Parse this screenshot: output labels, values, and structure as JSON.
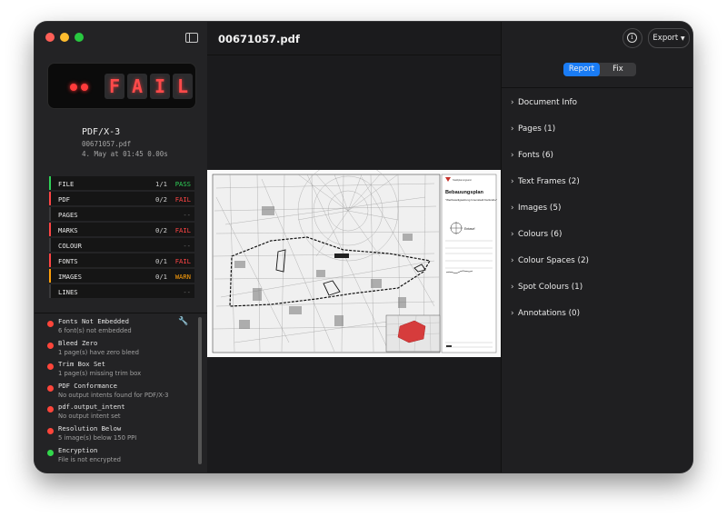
{
  "window": {
    "title": "00671057.pdf"
  },
  "summary": {
    "result_text": [
      "F",
      "A",
      "I",
      "L"
    ],
    "standard": "PDF/X-3",
    "filename": "00671057.pdf",
    "timestamp": "4. May at 01:45  0.00s"
  },
  "checks": [
    {
      "label": "FILE",
      "count": "1/1",
      "status": "PASS",
      "color": "#2fd158"
    },
    {
      "label": "PDF",
      "count": "0/2",
      "status": "FAIL",
      "color": "#ff4545"
    },
    {
      "label": "PAGES",
      "count": "",
      "status": "--",
      "color": "#3a3a3c"
    },
    {
      "label": "MARKS",
      "count": "0/2",
      "status": "FAIL",
      "color": "#ff4545"
    },
    {
      "label": "COLOUR",
      "count": "",
      "status": "--",
      "color": "#3a3a3c"
    },
    {
      "label": "FONTS",
      "count": "0/1",
      "status": "FAIL",
      "color": "#ff4545"
    },
    {
      "label": "IMAGES",
      "count": "0/1",
      "status": "WARN",
      "color": "#ff9f0a"
    },
    {
      "label": "LINES",
      "count": "",
      "status": "--",
      "color": "#3a3a3c"
    }
  ],
  "issues": [
    {
      "title": "Fonts Not Embedded",
      "subtitle": "6 font(s) not embedded",
      "color": "#ff453a"
    },
    {
      "title": "Bleed Zero",
      "subtitle": "1 page(s) have zero bleed",
      "color": "#ff453a"
    },
    {
      "title": "Trim Box Set",
      "subtitle": "1 page(s) missing trim box",
      "color": "#ff453a"
    },
    {
      "title": "PDF Conformance",
      "subtitle": "No output intents found for PDF/X-3",
      "color": "#ff453a"
    },
    {
      "title": "pdf.output_intent",
      "subtitle": "No output intent set",
      "color": "#ff453a"
    },
    {
      "title": "Resolution Below",
      "subtitle": "5 image(s) below 150 PPI",
      "color": "#ff453a"
    },
    {
      "title": "Encryption",
      "subtitle": "File is not encrypted",
      "color": "#32d74b"
    }
  ],
  "document": {
    "plan_title": "Bebauungsplan",
    "plan_subtitle": "\"Wertbeteiligsatzung Innenstadt Karlsruhe\"",
    "plan_label": "Entwurf"
  },
  "toolbar": {
    "export_label": "Export"
  },
  "tabs": [
    {
      "label": "Report",
      "active": true
    },
    {
      "label": "Fix",
      "active": false
    }
  ],
  "report_sections": [
    "Document Info",
    "Pages (1)",
    "Fonts (6)",
    "Text Frames (2)",
    "Images (5)",
    "Colours (6)",
    "Colour Spaces (2)",
    "Spot Colours (1)",
    "Annotations (0)"
  ],
  "icons": {
    "sidebar_toggle": "sidebar-icon",
    "info": "info-icon",
    "wrench": "wrench-icon",
    "chevron": "chevron-right-icon"
  }
}
